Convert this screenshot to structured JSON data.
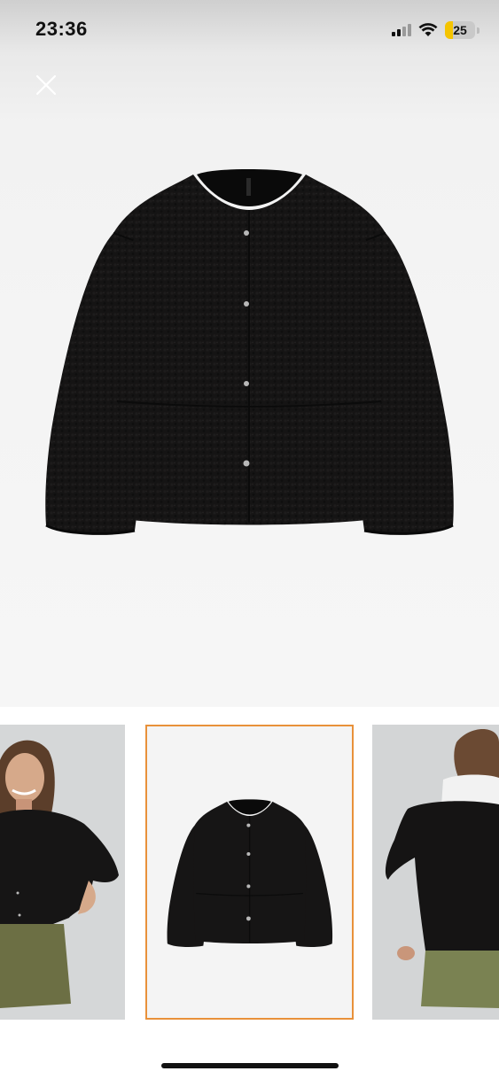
{
  "status_bar": {
    "time": "23:36",
    "battery_level": "25",
    "battery_fraction": 0.25,
    "signal_bars_active": 2,
    "signal_bars_total": 4,
    "icons": [
      "cellular-signal-icon",
      "wifi-icon",
      "battery-icon"
    ]
  },
  "viewer": {
    "close_icon": "close-icon",
    "main_image": "black-teddy-fleece-jacket-product-photo",
    "selected_index": 1
  },
  "thumbnails": [
    {
      "image": "model-front-jacket-photo",
      "selected": false
    },
    {
      "image": "jacket-product-photo",
      "selected": true
    },
    {
      "image": "model-back-jacket-photo",
      "selected": false
    }
  ],
  "colors": {
    "selection_border": "#e8913a",
    "battery_fill": "#f5c400",
    "garment": "#141313"
  }
}
